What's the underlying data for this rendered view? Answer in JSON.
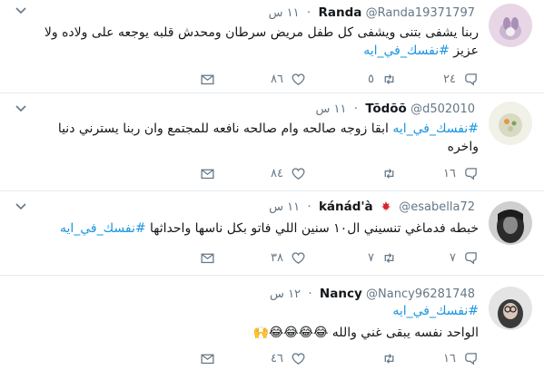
{
  "tweets": [
    {
      "name": "Randa",
      "handle": "@Randa19371797",
      "time": "١١ س",
      "text_lines": [
        "ربنا يشفى بتنى ويشفى كل طفل مريض سرطان ومحدش قلبه يوجعه على ولاده ولا",
        "عزيز "
      ],
      "hashtag": "#نفسك_في_ايه",
      "hashtag_position": "end",
      "replies": "٢٤",
      "retweets": "٥",
      "likes": "٨٦"
    },
    {
      "name": "Tõdõõ",
      "handle": "@d502010",
      "time": "١١ س",
      "hashtag": "#نفسك_في_ايه",
      "hashtag_position": "start",
      "text_lines": [
        " ابقا زوجه صالحه وام صالحه نافعه للمجتمع وان ربنا يسترني دنيا",
        "واخره"
      ],
      "replies": "١٦",
      "retweets": "",
      "likes": "٨٤"
    },
    {
      "name": "kánád'à",
      "handle": "@esabella72",
      "time": "١١ س",
      "text_lines": [
        "خبطه فدماغي تنسيني ال١٠ سنين اللي فاتو بكل ناسها واحداثها "
      ],
      "hashtag": "#نفسك_في_ايه",
      "hashtag_position": "end",
      "replies": "٧",
      "retweets": "٧",
      "likes": "٣٨"
    },
    {
      "name": "Nancy",
      "handle": "@Nancy96281748",
      "time": "١٢ س",
      "hashtag": "#نفسك_في_ايه",
      "text_lines": [
        "الواحد نفسه يبقى غني والله 😂😂😂😂🙌"
      ],
      "replies": "١٦",
      "retweets": "",
      "likes": "٤٦"
    }
  ],
  "icons": {
    "reply": "reply-icon",
    "retweet": "retweet-icon",
    "like": "heart-icon",
    "dm": "envelope-icon",
    "caret": "chevron-down-icon",
    "flag": "canada-flag-icon"
  },
  "colors": {
    "hashtag": "#1b95e0",
    "meta": "#657786",
    "text": "#14171a"
  }
}
